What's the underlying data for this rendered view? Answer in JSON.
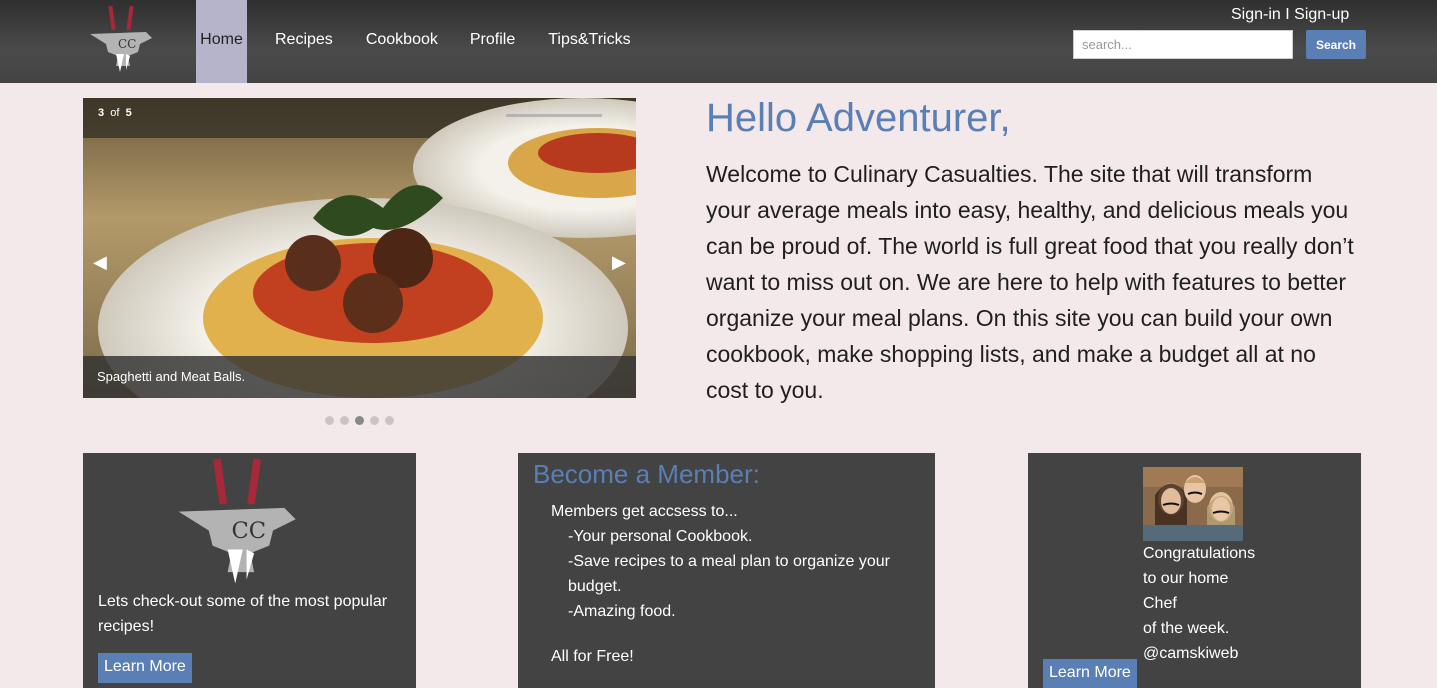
{
  "header": {
    "logo_text": "CC",
    "nav": [
      {
        "label": "Home"
      },
      {
        "label": "Recipes"
      },
      {
        "label": "Cookbook"
      },
      {
        "label": "Profile"
      },
      {
        "label": "Tips&Tricks"
      }
    ],
    "sign_in": "Sign-in",
    "separator": " I ",
    "sign_up": "Sign-up",
    "search_placeholder": "search...",
    "search_button": "Search"
  },
  "slideshow": {
    "current": "3",
    "of": "of",
    "total": "5",
    "caption": "Spaghetti and Meat Balls.",
    "dot_count": 5,
    "active_dot": 3
  },
  "intro": {
    "title": "Hello Adventurer,",
    "text": "Welcome to Culinary Casualties. The site that will transform your average meals into easy, healthy, and delicious meals you can be proud of. The world is full great food that you really don’t want to miss out on. We are here to help with features to better organize your meal plans. On this site you can build your own cookbook, make shopping lists, and make a budget all at no cost to you."
  },
  "cards": {
    "popular": {
      "text": "Lets check-out some of the most popular recipes!",
      "button": "Learn More"
    },
    "member": {
      "title": "Become a Member:",
      "intro": "Members get accsess to...",
      "items": [
        "-Your personal Cookbook.",
        "-Save recipes to a meal plan to organize your budget.",
        "-Amazing food."
      ],
      "footer": "All for Free!"
    },
    "chef": {
      "lines": [
        "Congratulations",
        "to our home",
        "Chef",
        "of the week.",
        "@camskiweb"
      ],
      "button": "Learn More"
    }
  },
  "colors": {
    "accent": "#5a7fb5",
    "header": "#444444",
    "page_bg": "#f3e8ea",
    "card_bg": "#434343",
    "active_nav": "#b5b4cb"
  }
}
